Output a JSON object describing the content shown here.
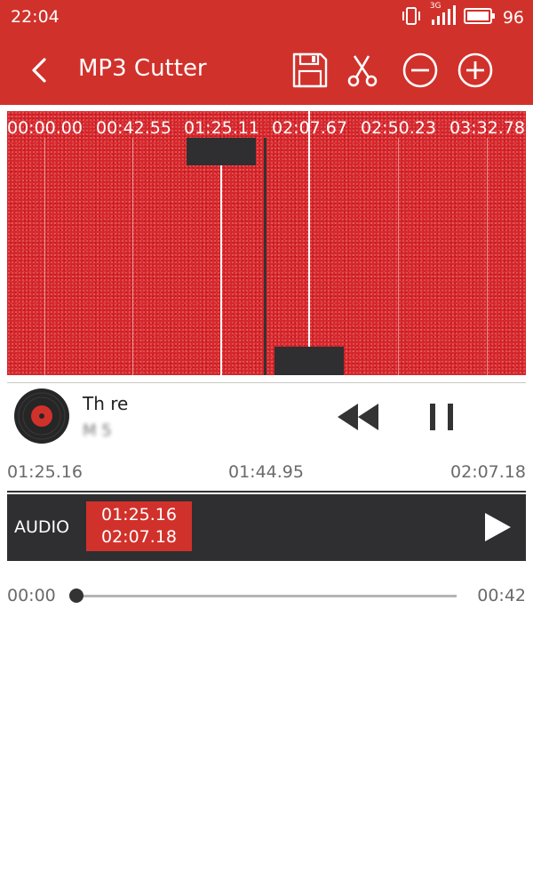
{
  "status_bar": {
    "time": "22:04",
    "network": "3G",
    "battery_percent": "96",
    "icons": [
      "vibrate-icon",
      "signal-icon",
      "battery-icon"
    ]
  },
  "app_bar": {
    "title": "MP3 Cutter",
    "icons": [
      "back-arrow-icon",
      "save-icon",
      "scissors-icon",
      "zoom-out-icon",
      "zoom-in-icon"
    ],
    "accent_color": "#d1312b"
  },
  "waveform": {
    "time_ticks": [
      "00:00.00",
      "00:42.55",
      "01:25.11",
      "02:07.67",
      "02:50.23",
      "03:32.78"
    ]
  },
  "track": {
    "title": "Th   re",
    "artist": "M      5",
    "icons": [
      "album-art-icon",
      "rewind-icon",
      "pause-icon"
    ]
  },
  "selection": {
    "start": "01:25.16",
    "middle": "01:44.95",
    "end": "02:07.18"
  },
  "segment": {
    "label": "AUDIO",
    "start": "01:25.16",
    "end": "02:07.18",
    "icon": "play-icon"
  },
  "playback": {
    "current": "00:00",
    "total": "00:42",
    "progress": 0
  }
}
